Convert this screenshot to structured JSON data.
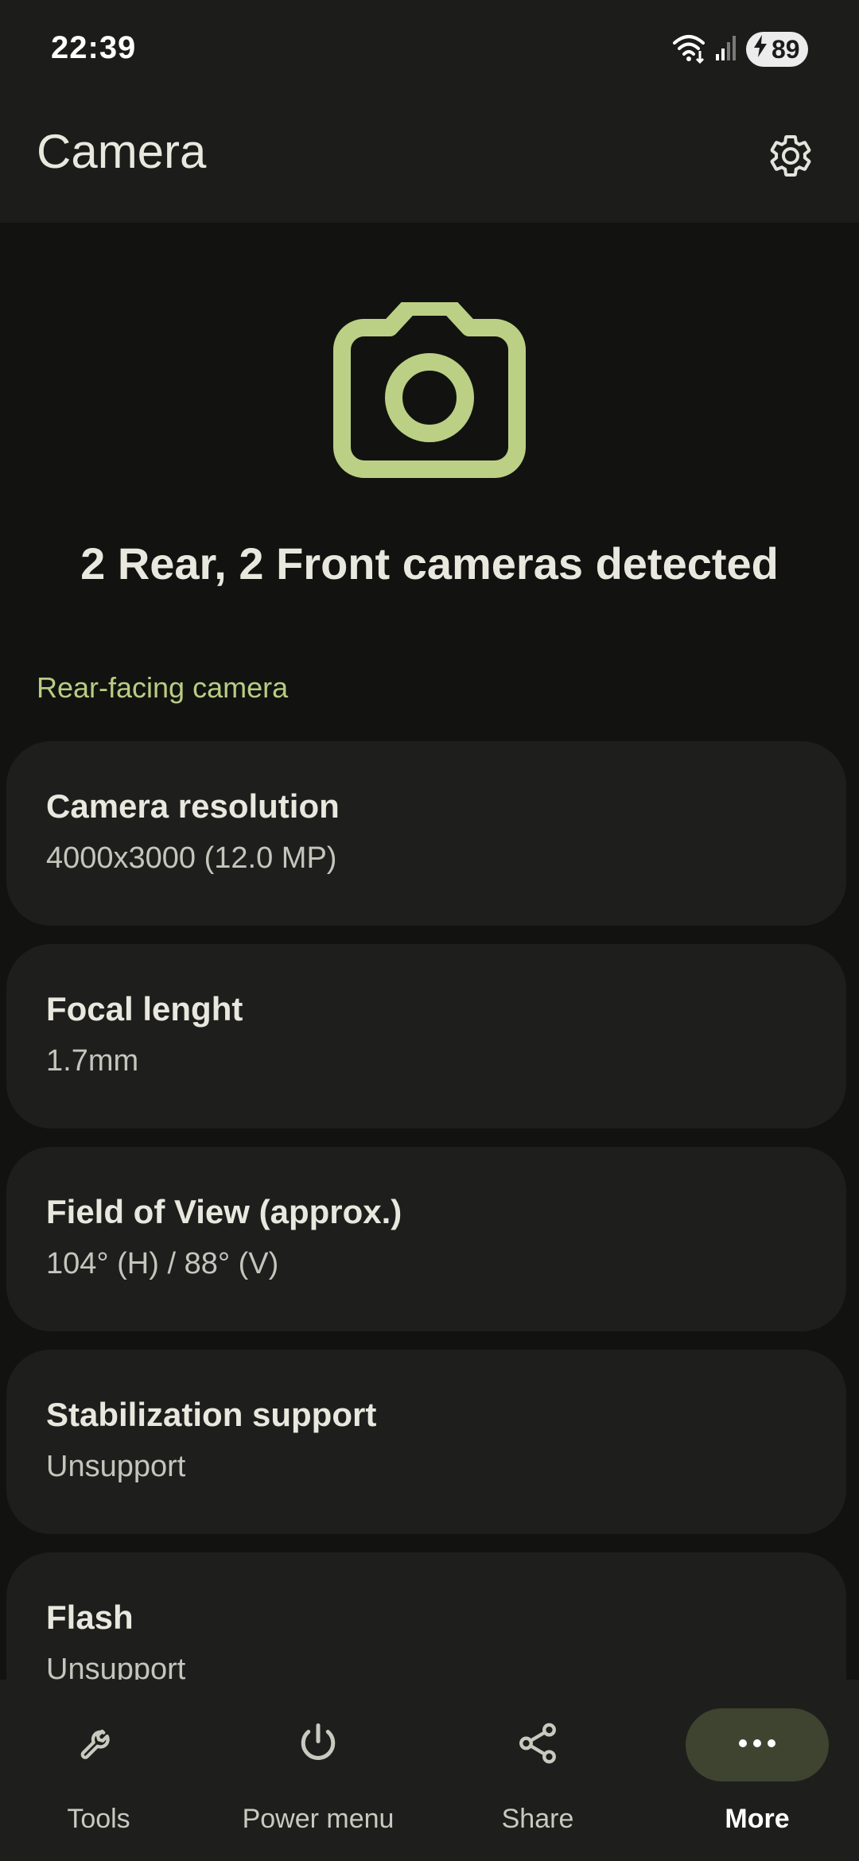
{
  "status_bar": {
    "time": "22:39",
    "battery_level": "89",
    "icons": [
      "wifi-icon",
      "signal-icon",
      "battery-charging-icon"
    ]
  },
  "app_bar": {
    "title": "Camera",
    "settings_icon": "gear-icon"
  },
  "hero": {
    "icon": "camera-icon",
    "summary": "2 Rear, 2 Front cameras detected"
  },
  "section": {
    "header": "Rear-facing camera"
  },
  "cards": [
    {
      "title": "Camera resolution",
      "value": "4000x3000 (12.0 MP)"
    },
    {
      "title": "Focal lenght",
      "value": "1.7mm"
    },
    {
      "title": "Field of View (approx.)",
      "value": "104° (H) / 88° (V)"
    },
    {
      "title": "Stabilization support",
      "value": "Unsupport"
    },
    {
      "title": "Flash",
      "value": "Unsupport"
    }
  ],
  "bottom_nav": {
    "items": [
      {
        "label": "Tools",
        "icon": "wrench-icon",
        "active": false
      },
      {
        "label": "Power menu",
        "icon": "power-icon",
        "active": false
      },
      {
        "label": "Share",
        "icon": "share-icon",
        "active": false
      },
      {
        "label": "More",
        "icon": "more-dots-icon",
        "active": true
      }
    ]
  },
  "colors": {
    "accent": "#b9cc84",
    "background": "#121310",
    "surface": "#1e1f1c",
    "active_indicator": "#3e4430"
  }
}
